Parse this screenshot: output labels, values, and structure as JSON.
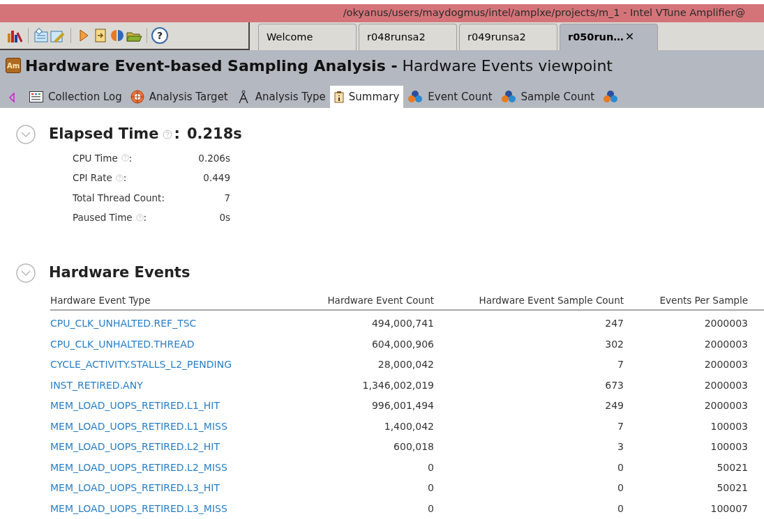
{
  "window": {
    "title": "/okyanus/users/maydogmus/intel/amplxe/projects/m_1 - Intel VTune Amplifier@"
  },
  "toolbar": {
    "help_label": "?"
  },
  "document_tabs": [
    {
      "label": "Welcome",
      "selected": false
    },
    {
      "label": "r048runsa2",
      "selected": false
    },
    {
      "label": "r049runsa2",
      "selected": false
    },
    {
      "label": "r050run…",
      "selected": true,
      "close": "✕"
    }
  ],
  "analysis_header": {
    "logo": "Am",
    "title": "**Hardware Event-based Sampling Analysis -** Hardware Events viewpoint"
  },
  "view_tabs": [
    {
      "label": "Collection Log",
      "kind": "log",
      "selected": false
    },
    {
      "label": "Analysis Target",
      "kind": "target",
      "selected": false
    },
    {
      "label": "Analysis Type",
      "kind": "type",
      "selected": false
    },
    {
      "label": "Summary",
      "kind": "summary",
      "selected": true
    },
    {
      "label": "Event Count",
      "kind": "events",
      "selected": false
    },
    {
      "label": "Sample Count",
      "kind": "events",
      "selected": false
    },
    {
      "kind": "events",
      "selected": false
    }
  ],
  "elapsed": {
    "label": "Elapsed Time",
    "separator": ":",
    "value": "0.218s",
    "expanded": true,
    "metrics": [
      {
        "label": "CPU Time",
        "help": true,
        "separator": ":",
        "value": "0.206s"
      },
      {
        "label": "CPI Rate",
        "help": true,
        "separator": ":",
        "value": "0.449"
      },
      {
        "label": "Total Thread Count",
        "help": false,
        "separator": ":",
        "value": "7"
      },
      {
        "label": "Paused Time",
        "help": true,
        "separator": ":",
        "value": "0s"
      }
    ]
  },
  "hardware_events": {
    "title": "Hardware Events",
    "expanded": true,
    "columns": [
      "Hardware Event Type",
      "Hardware Event Count",
      "Hardware Event Sample Count",
      "Events Per Sample"
    ],
    "rows": [
      [
        "CPU_CLK_UNHALTED.REF_TSC",
        "494,000,741",
        "247",
        "2000003"
      ],
      [
        "CPU_CLK_UNHALTED.THREAD",
        "604,000,906",
        "302",
        "2000003"
      ],
      [
        "CYCLE_ACTIVITY.STALLS_L2_PENDING",
        "28,000,042",
        "7",
        "2000003"
      ],
      [
        "INST_RETIRED.ANY",
        "1,346,002,019",
        "673",
        "2000003"
      ],
      [
        "MEM_LOAD_UOPS_RETIRED.L1_HIT",
        "996,001,494",
        "249",
        "2000003"
      ],
      [
        "MEM_LOAD_UOPS_RETIRED.L1_MISS",
        "1,400,042",
        "7",
        "100003"
      ],
      [
        "MEM_LOAD_UOPS_RETIRED.L2_HIT",
        "600,018",
        "3",
        "100003"
      ],
      [
        "MEM_LOAD_UOPS_RETIRED.L2_MISS",
        "0",
        "0",
        "50021"
      ],
      [
        "MEM_LOAD_UOPS_RETIRED.L3_HIT",
        "0",
        "0",
        "50021"
      ],
      [
        "MEM_LOAD_UOPS_RETIRED.L3_MISS",
        "0",
        "0",
        "100007"
      ]
    ]
  }
}
